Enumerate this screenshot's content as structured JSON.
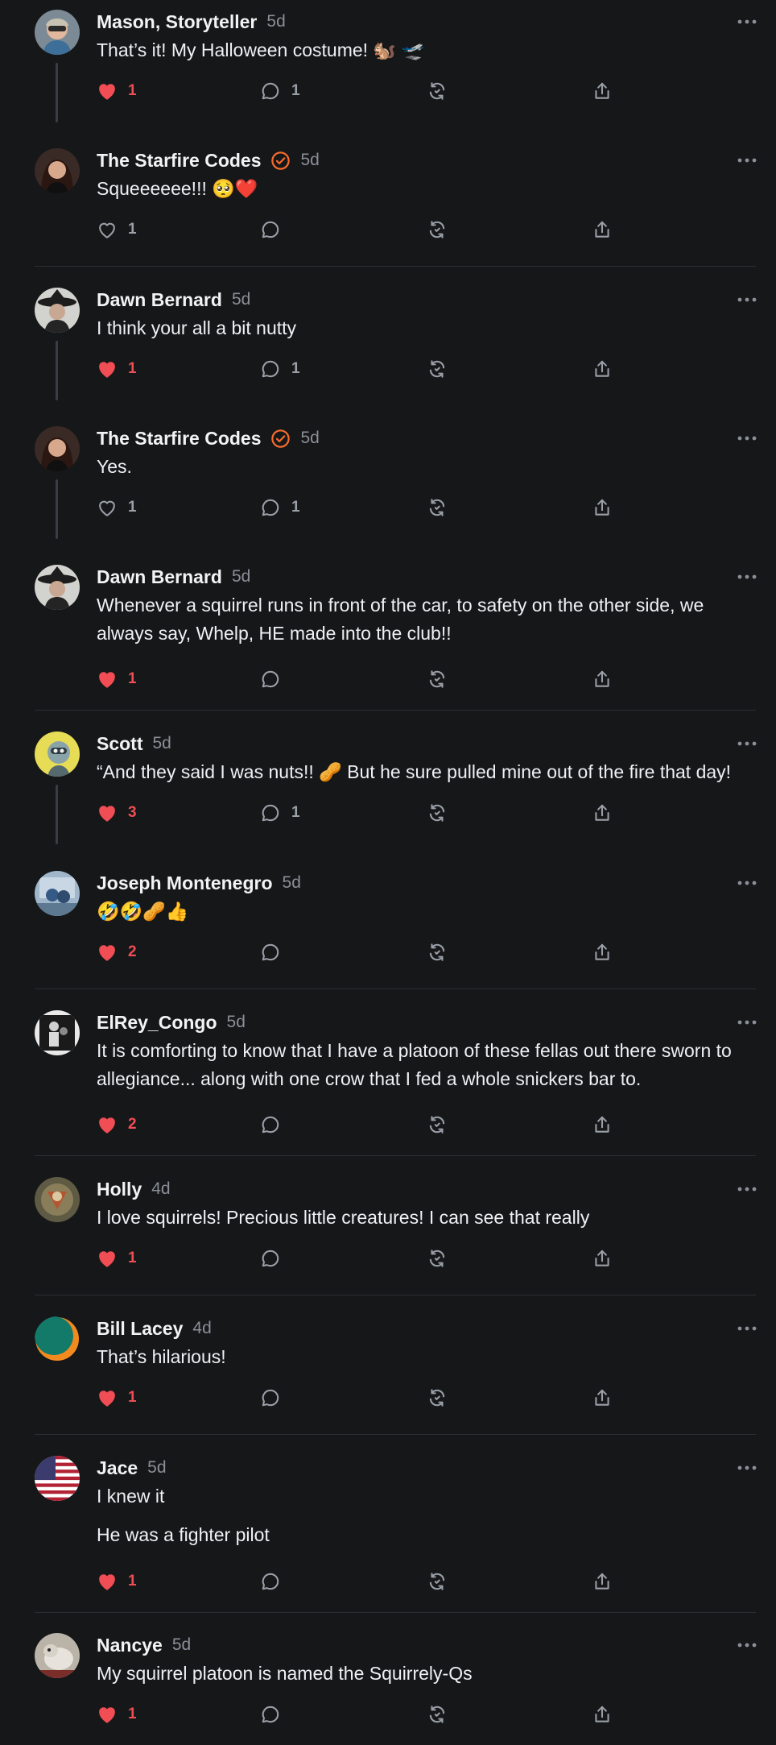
{
  "colors": {
    "background": "#161719",
    "like": "#f04d54",
    "muted": "#8a8f98",
    "verified": "#f46b2c"
  },
  "posts": [
    {
      "name": "Mason, Storyteller",
      "time": "5d",
      "verified": false,
      "lines": [
        "That’s it! My Halloween costume! 🐿️ 🛫"
      ],
      "likes": "1",
      "liked": true,
      "replies": "1"
    },
    {
      "name": "The Starfire Codes",
      "time": "5d",
      "verified": true,
      "lines": [
        "Squeeeeee!!! 🥺❤️"
      ],
      "likes": "1",
      "liked": false,
      "replies": ""
    },
    {
      "name": "Dawn Bernard",
      "time": "5d",
      "verified": false,
      "lines": [
        "I think your all a bit nutty"
      ],
      "likes": "1",
      "liked": true,
      "replies": "1"
    },
    {
      "name": "The Starfire Codes",
      "time": "5d",
      "verified": true,
      "lines": [
        "Yes."
      ],
      "likes": "1",
      "liked": false,
      "replies": "1"
    },
    {
      "name": "Dawn Bernard",
      "time": "5d",
      "verified": false,
      "lines": [
        "Whenever a squirrel runs in front of the car, to safety on the other side, we",
        "always say, Whelp, HE made into the club!!"
      ],
      "likes": "1",
      "liked": true,
      "replies": ""
    },
    {
      "name": "Scott",
      "time": "5d",
      "verified": false,
      "lines": [
        "“And they said I was nuts!! 🥜 But he sure pulled mine out of the fire that day!"
      ],
      "likes": "3",
      "liked": true,
      "replies": "1"
    },
    {
      "name": "Joseph Montenegro",
      "time": "5d",
      "verified": false,
      "lines": [
        "🤣🤣🥜👍"
      ],
      "likes": "2",
      "liked": true,
      "replies": ""
    },
    {
      "name": "ElRey_Congo",
      "time": "5d",
      "verified": false,
      "lines": [
        "It is comforting to know that I have a platoon of these fellas out there sworn to",
        "allegiance... along with one crow that I fed a whole snickers bar to."
      ],
      "likes": "2",
      "liked": true,
      "replies": ""
    },
    {
      "name": "Holly",
      "time": "4d",
      "verified": false,
      "lines": [
        "I love squirrels! Precious little creatures! I can see that really"
      ],
      "likes": "1",
      "liked": true,
      "replies": ""
    },
    {
      "name": "Bill Lacey",
      "time": "4d",
      "verified": false,
      "lines": [
        "That’s hilarious!"
      ],
      "likes": "1",
      "liked": true,
      "replies": ""
    },
    {
      "name": "Jace",
      "time": "5d",
      "verified": false,
      "lines": [
        "I knew it",
        "He was a fighter pilot"
      ],
      "likes": "1",
      "liked": true,
      "replies": ""
    },
    {
      "name": "Nancye",
      "time": "5d",
      "verified": false,
      "lines": [
        "My squirrel platoon is named the Squirrely-Qs"
      ],
      "likes": "1",
      "liked": true,
      "replies": ""
    }
  ]
}
